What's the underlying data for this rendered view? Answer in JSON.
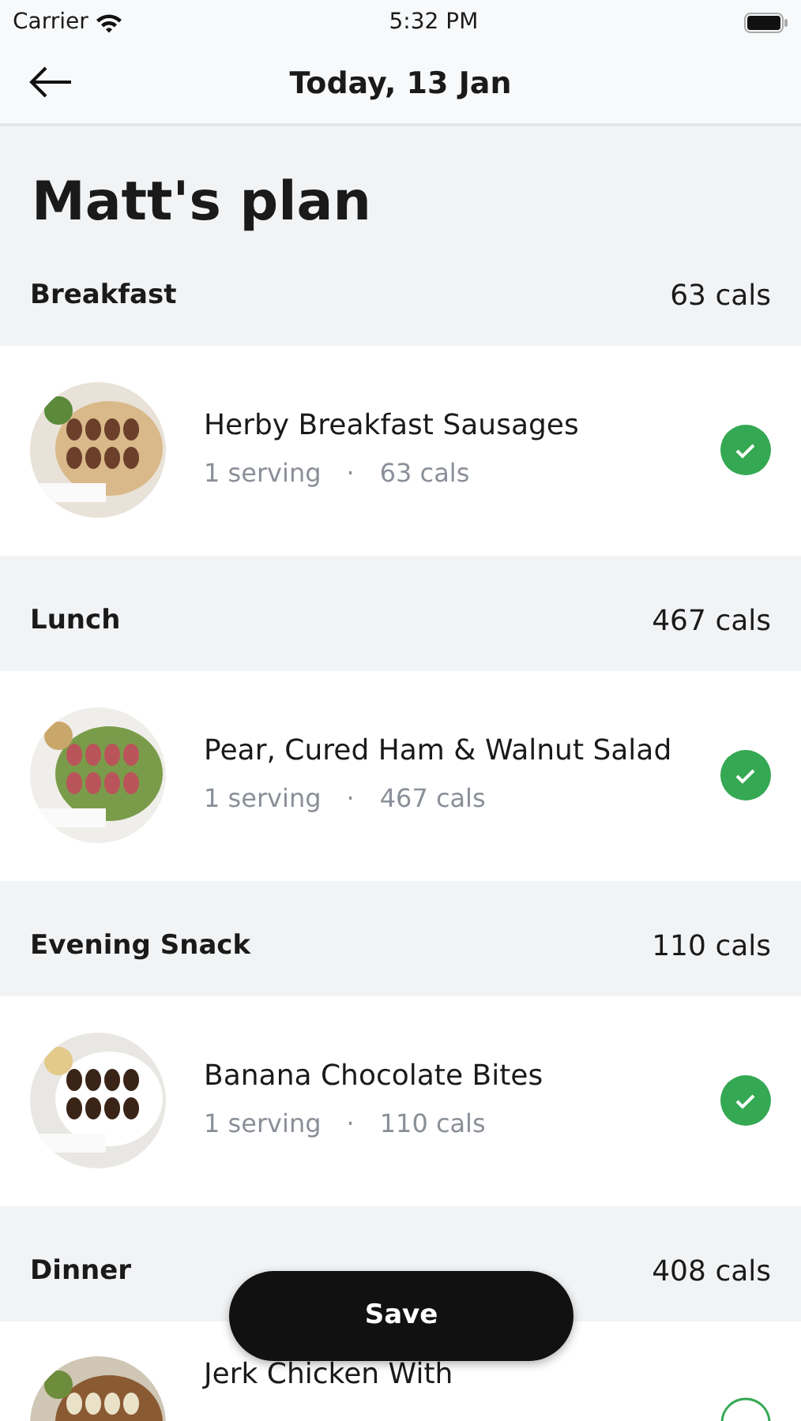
{
  "status_bar": {
    "carrier": "Carrier",
    "time": "5:32 PM"
  },
  "nav": {
    "title": "Today, 13 Jan"
  },
  "plan_title": "Matt's plan",
  "meals": [
    {
      "name": "Breakfast",
      "cals": "63 cals",
      "items": [
        {
          "title": "Herby Breakfast Sausages",
          "serving": "1 serving",
          "separator": "·",
          "cals": "63 cals",
          "checked": true
        }
      ]
    },
    {
      "name": "Lunch",
      "cals": "467 cals",
      "items": [
        {
          "title": "Pear, Cured Ham & Walnut Salad",
          "serving": "1 serving",
          "separator": "·",
          "cals": "467 cals",
          "checked": true
        }
      ]
    },
    {
      "name": "Evening Snack",
      "cals": "110 cals",
      "items": [
        {
          "title": "Banana Chocolate Bites",
          "serving": "1 serving",
          "separator": "·",
          "cals": "110 cals",
          "checked": true
        }
      ]
    },
    {
      "name": "Dinner",
      "cals": "408 cals",
      "items": [
        {
          "title": "Jerk Chicken With",
          "checked": false
        }
      ]
    }
  ],
  "save_button": "Save"
}
